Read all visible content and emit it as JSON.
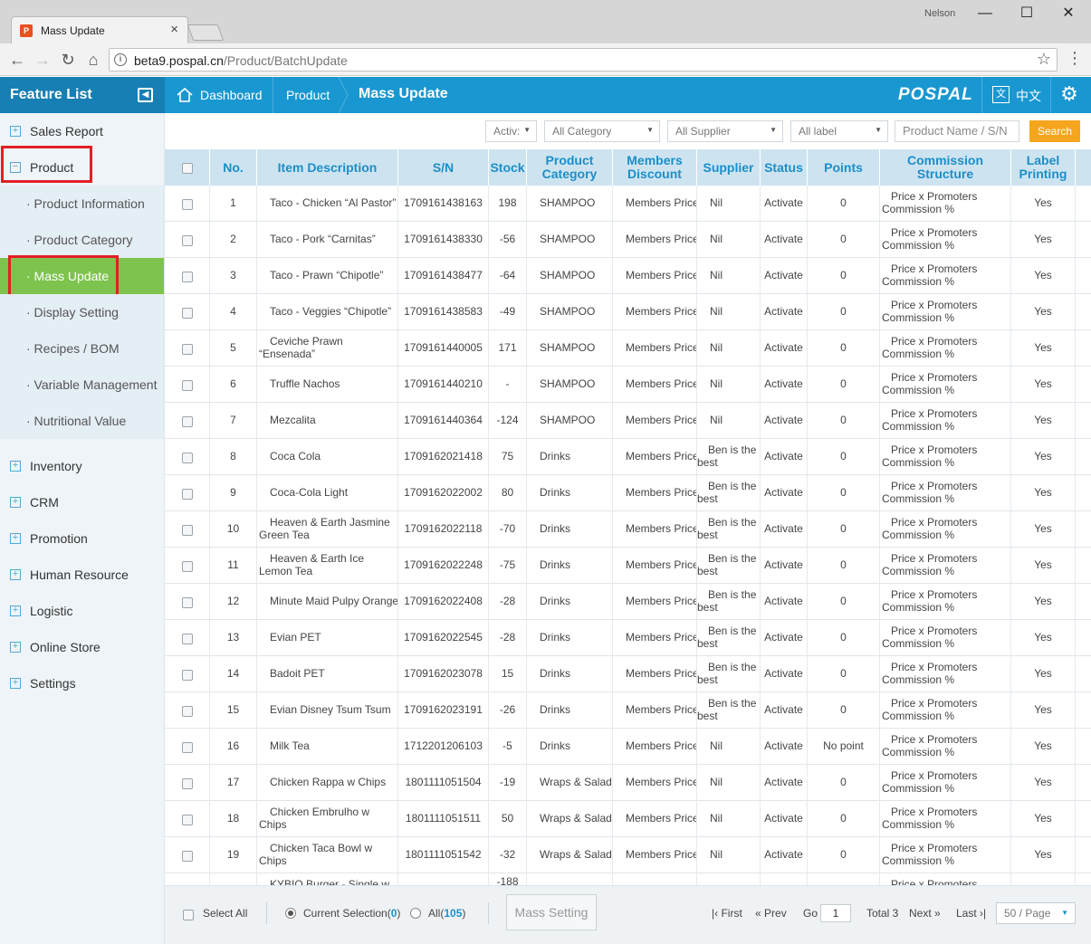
{
  "browser": {
    "tab_title": "Mass Update",
    "tab_close": "×",
    "user": "Nelson",
    "url_host": "beta9.pospal.cn",
    "url_path": "/Product/BatchUpdate"
  },
  "header": {
    "feature_list": "Feature List",
    "breadcrumb": [
      "Dashboard",
      "Product"
    ],
    "page_title": "Mass Update",
    "brand": "POSPAL",
    "lang_icon": "文",
    "lang": "中文"
  },
  "sidebar": {
    "items": [
      {
        "label": "Sales Report",
        "sign": "+"
      },
      {
        "label": "Product",
        "sign": "−"
      },
      {
        "label": "Inventory",
        "sign": "+"
      },
      {
        "label": "CRM",
        "sign": "+"
      },
      {
        "label": "Promotion",
        "sign": "+"
      },
      {
        "label": "Human Resource",
        "sign": "+"
      },
      {
        "label": "Logistic",
        "sign": "+"
      },
      {
        "label": "Online Store",
        "sign": "+"
      },
      {
        "label": "Settings",
        "sign": "+"
      }
    ],
    "sub_items": [
      "· Product Information",
      "· Product Category",
      "· Mass Update",
      "· Display Setting",
      "· Recipes / BOM",
      "· Variable Management",
      "· Nutritional Value"
    ],
    "active_sub": "· Mass Update"
  },
  "filters": {
    "status": "Activ:",
    "category": "All Category",
    "supplier": "All Supplier",
    "label": "All label",
    "search_placeholder": "Product Name / S/N",
    "search_button": "Search"
  },
  "table": {
    "headers": [
      "No.",
      "Item Description",
      "S/N",
      "Stock",
      "Product Category",
      "Members Discount",
      "Supplier",
      "Status",
      "Points",
      "Commission Structure",
      "Label Printing"
    ],
    "commission_line1": "Price x Promoters",
    "commission_line2": "Commission %",
    "rows": [
      {
        "no": "1",
        "desc": "Taco - Chicken “Al Pastor”",
        "sn": "1709161438163",
        "stock": "198",
        "category": "SHAMPOO",
        "discount": "Members Price",
        "supplier": "Nil",
        "status": "Activate",
        "points": "0",
        "label": "Yes"
      },
      {
        "no": "2",
        "desc": "Taco - Pork “Carnitas”",
        "sn": "1709161438330",
        "stock": "-56",
        "category": "SHAMPOO",
        "discount": "Members Price",
        "supplier": "Nil",
        "status": "Activate",
        "points": "0",
        "label": "Yes"
      },
      {
        "no": "3",
        "desc": "Taco - Prawn “Chipotle”",
        "sn": "1709161438477",
        "stock": "-64",
        "category": "SHAMPOO",
        "discount": "Members Price",
        "supplier": "Nil",
        "status": "Activate",
        "points": "0",
        "label": "Yes"
      },
      {
        "no": "4",
        "desc": "Taco - Veggies “Chipotle”",
        "sn": "1709161438583",
        "stock": "-49",
        "category": "SHAMPOO",
        "discount": "Members Price",
        "supplier": "Nil",
        "status": "Activate",
        "points": "0",
        "label": "Yes"
      },
      {
        "no": "5",
        "desc1": "Ceviche Prawn",
        "desc2": "“Ensenada”",
        "sn": "1709161440005",
        "stock": "171",
        "category": "SHAMPOO",
        "discount": "Members Price",
        "supplier": "Nil",
        "status": "Activate",
        "points": "0",
        "label": "Yes"
      },
      {
        "no": "6",
        "desc": "Truffle Nachos",
        "sn": "1709161440210",
        "stock": "-",
        "category": "SHAMPOO",
        "discount": "Members Price",
        "supplier": "Nil",
        "status": "Activate",
        "points": "0",
        "label": "Yes"
      },
      {
        "no": "7",
        "desc": "Mezcalita",
        "sn": "1709161440364",
        "stock": "-124",
        "category": "SHAMPOO",
        "discount": "Members Price",
        "supplier": "Nil",
        "status": "Activate",
        "points": "0",
        "label": "Yes"
      },
      {
        "no": "8",
        "desc": "Coca Cola",
        "sn": "1709162021418",
        "stock": "75",
        "category": "Drinks",
        "discount": "Members Price",
        "supplier1": "Ben is the",
        "supplier2": "best",
        "status": "Activate",
        "points": "0",
        "label": "Yes"
      },
      {
        "no": "9",
        "desc": "Coca-Cola Light",
        "sn": "1709162022002",
        "stock": "80",
        "category": "Drinks",
        "discount": "Members Price",
        "supplier1": "Ben is the",
        "supplier2": "best",
        "status": "Activate",
        "points": "0",
        "label": "Yes"
      },
      {
        "no": "10",
        "desc1": "Heaven & Earth Jasmine",
        "desc2": "Green Tea",
        "sn": "1709162022118",
        "stock": "-70",
        "category": "Drinks",
        "discount": "Members Price",
        "supplier1": "Ben is the",
        "supplier2": "best",
        "status": "Activate",
        "points": "0",
        "label": "Yes"
      },
      {
        "no": "11",
        "desc1": "Heaven & Earth Ice",
        "desc2": "Lemon Tea",
        "sn": "1709162022248",
        "stock": "-75",
        "category": "Drinks",
        "discount": "Members Price",
        "supplier1": "Ben is the",
        "supplier2": "best",
        "status": "Activate",
        "points": "0",
        "label": "Yes"
      },
      {
        "no": "12",
        "desc": "Minute Maid Pulpy Orange",
        "sn": "1709162022408",
        "stock": "-28",
        "category": "Drinks",
        "discount": "Members Price",
        "supplier1": "Ben is the",
        "supplier2": "best",
        "status": "Activate",
        "points": "0",
        "label": "Yes"
      },
      {
        "no": "13",
        "desc": "Evian PET",
        "sn": "1709162022545",
        "stock": "-28",
        "category": "Drinks",
        "discount": "Members Price",
        "supplier1": "Ben is the",
        "supplier2": "best",
        "status": "Activate",
        "points": "0",
        "label": "Yes"
      },
      {
        "no": "14",
        "desc": "Badoit PET",
        "sn": "1709162023078",
        "stock": "15",
        "category": "Drinks",
        "discount": "Members Price",
        "supplier1": "Ben is the",
        "supplier2": "best",
        "status": "Activate",
        "points": "0",
        "label": "Yes"
      },
      {
        "no": "15",
        "desc": "Evian Disney Tsum Tsum",
        "sn": "1709162023191",
        "stock": "-26",
        "category": "Drinks",
        "discount": "Members Price",
        "supplier1": "Ben is the",
        "supplier2": "best",
        "status": "Activate",
        "points": "0",
        "label": "Yes"
      },
      {
        "no": "16",
        "desc": "Milk Tea",
        "sn": "1712201206103",
        "stock": "-5",
        "category": "Drinks",
        "discount": "Members Price",
        "supplier": "Nil",
        "status": "Activate",
        "points": "No point",
        "label": "Yes"
      },
      {
        "no": "17",
        "desc": "Chicken Rappa w Chips",
        "sn": "1801111051504",
        "stock": "-19",
        "category": "Wraps & Salad",
        "discount": "Members Price",
        "supplier": "Nil",
        "status": "Activate",
        "points": "0",
        "label": "Yes"
      },
      {
        "no": "18",
        "desc1": "Chicken Embrulho w",
        "desc2": "Chips",
        "sn": "1801111051511",
        "stock": "50",
        "category": "Wraps & Salad",
        "discount": "Members Price",
        "supplier": "Nil",
        "status": "Activate",
        "points": "0",
        "label": "Yes"
      },
      {
        "no": "19",
        "desc1": "Chicken Taca Bowl w",
        "desc2": "Chips",
        "sn": "1801111051542",
        "stock": "-32",
        "category": "Wraps & Salad",
        "discount": "Members Price",
        "supplier": "Nil",
        "status": "Activate",
        "points": "0",
        "label": "Yes"
      },
      {
        "no": "",
        "desc1": "KYBIO Burger - Single w",
        "desc2": "",
        "sn": "",
        "stock": "-188",
        "category": "",
        "discount": "",
        "supplier": "",
        "status": "",
        "points": "",
        "label": ""
      }
    ]
  },
  "footer": {
    "select_all": "Select All",
    "current_selection_label": "Current Selection(",
    "current_selection_count": "0",
    "all_label": "All(",
    "all_count": "105",
    "close_paren": ")",
    "mass_setting": "Mass Setting",
    "first": "First",
    "prev": "Prev",
    "go": "Go",
    "page": "1",
    "total": "Total 3",
    "next": "Next",
    "last": "Last",
    "per_page": "50 / Page"
  }
}
